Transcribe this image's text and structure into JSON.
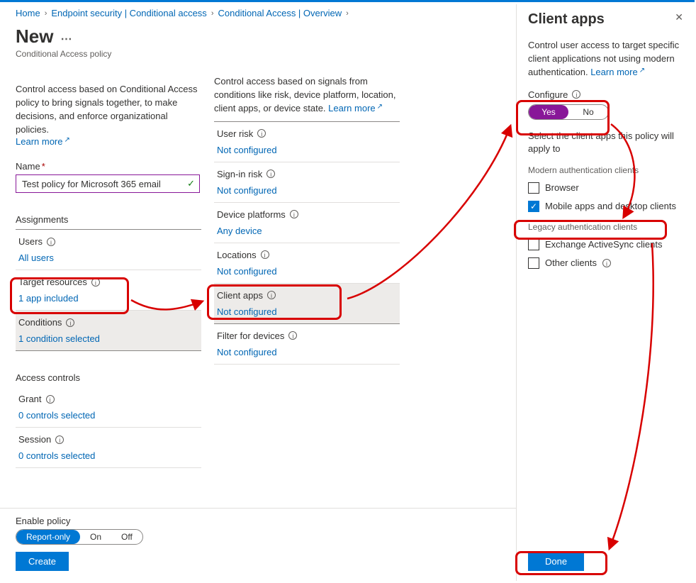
{
  "breadcrumb": [
    "Home",
    "Endpoint security | Conditional access",
    "Conditional Access | Overview"
  ],
  "page": {
    "title": "New",
    "subtitle": "Conditional Access policy",
    "intro": "Control access based on Conditional Access policy to bring signals together, to make decisions, and enforce organizational policies.",
    "learn_more": "Learn more"
  },
  "name": {
    "label": "Name",
    "value": "Test policy for Microsoft 365 email"
  },
  "assignments": {
    "header": "Assignments",
    "users": {
      "label": "Users",
      "value": "All users"
    },
    "target": {
      "label": "Target resources",
      "value": "1 app included"
    },
    "conditions": {
      "label": "Conditions",
      "value": "1 condition selected"
    }
  },
  "access_controls": {
    "header": "Access controls",
    "grant": {
      "label": "Grant",
      "value": "0 controls selected"
    },
    "session": {
      "label": "Session",
      "value": "0 controls selected"
    }
  },
  "conditions_col": {
    "intro": "Control access based on signals from conditions like risk, device platform, location, client apps, or device state.",
    "learn_more": "Learn more",
    "rows": [
      {
        "label": "User risk",
        "value": "Not configured"
      },
      {
        "label": "Sign-in risk",
        "value": "Not configured"
      },
      {
        "label": "Device platforms",
        "value": "Any device"
      },
      {
        "label": "Locations",
        "value": "Not configured"
      },
      {
        "label": "Client apps",
        "value": "Not configured"
      },
      {
        "label": "Filter for devices",
        "value": "Not configured"
      }
    ]
  },
  "footer": {
    "enable_label": "Enable policy",
    "options": [
      "Report-only",
      "On",
      "Off"
    ],
    "create": "Create"
  },
  "blade": {
    "title": "Client apps",
    "intro": "Control user access to target specific client applications not using modern authentication.",
    "learn_more": "Learn more",
    "configure_label": "Configure",
    "yes": "Yes",
    "no": "No",
    "select_intro": "Select the client apps this policy will apply to",
    "group1": "Modern authentication clients",
    "cb_browser": "Browser",
    "cb_mobile": "Mobile apps and desktop clients",
    "group2": "Legacy authentication clients",
    "cb_eas": "Exchange ActiveSync clients",
    "cb_other": "Other clients",
    "done": "Done"
  }
}
